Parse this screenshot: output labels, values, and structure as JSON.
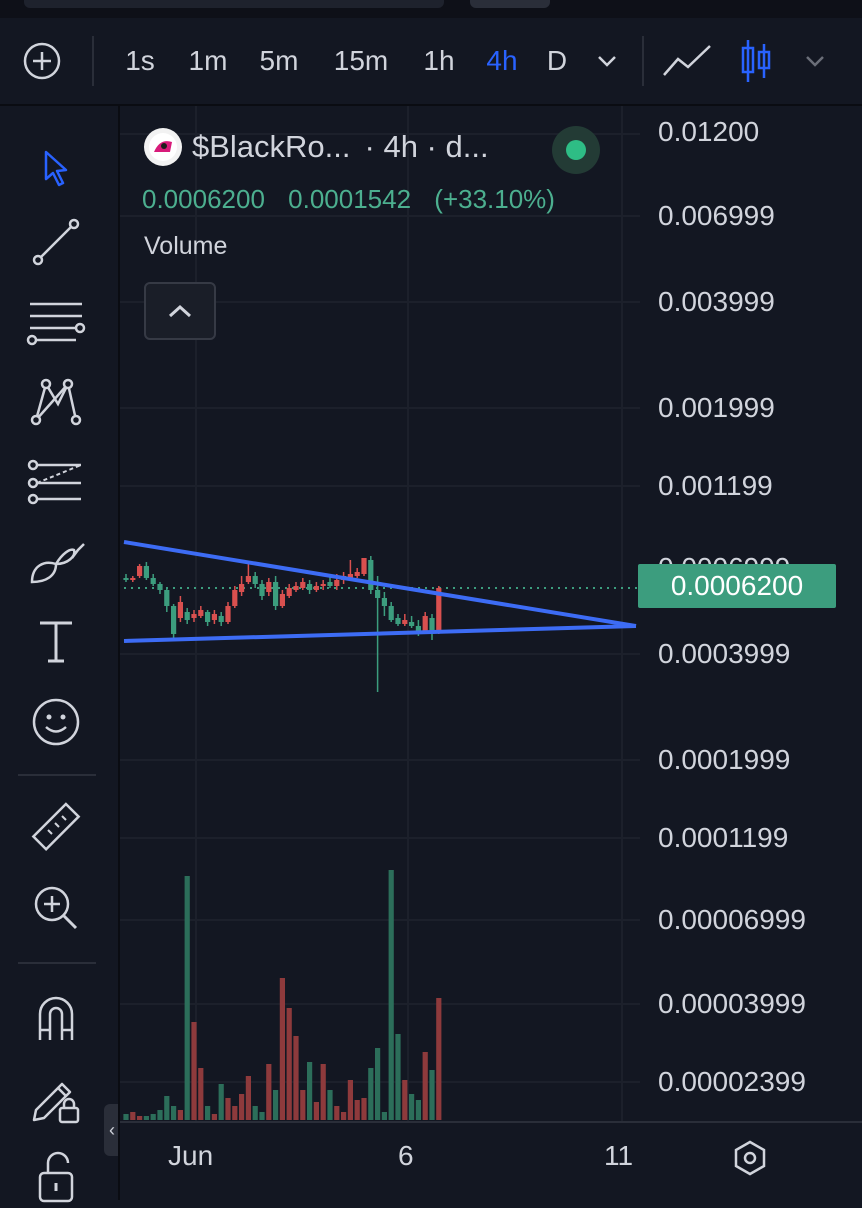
{
  "toolbar": {
    "intervals": [
      "1s",
      "1m",
      "5m",
      "15m",
      "1h",
      "4h",
      "D"
    ],
    "active_interval": "4h"
  },
  "legend": {
    "symbol": "$BlackRo...",
    "interval": "· 4h · d...",
    "price": "0.0006200",
    "change": "0.0001542",
    "change_pct": "(+33.10%)",
    "volume_label": "Volume"
  },
  "price_scale": {
    "labels": [
      "0.01200",
      "0.006999",
      "0.003999",
      "0.001999",
      "0.001199",
      "0.0006999",
      "0.0003999",
      "0.0001999",
      "0.0001199",
      "0.00006999",
      "0.00003999",
      "0.00002399"
    ],
    "current_price": "0.0006200"
  },
  "time_scale": {
    "labels": [
      "Jun",
      "6",
      "11"
    ]
  },
  "colors": {
    "background": "#131722",
    "up": "#3c9d7e",
    "down": "#d9504f",
    "trendline": "#3d6cf5",
    "accent": "#2962ff"
  },
  "icons": [
    "plus-icon",
    "chevron-down-icon",
    "line-chart-icon",
    "candlestick-icon",
    "cursor-icon",
    "trendline-icon",
    "fib-lines-icon",
    "pattern-icon",
    "forecast-icon",
    "brush-icon",
    "text-icon",
    "emoji-icon",
    "ruler-icon",
    "zoom-in-icon",
    "magnet-icon",
    "pencil-lock-icon",
    "lock-icon",
    "settings-hex-icon"
  ]
}
